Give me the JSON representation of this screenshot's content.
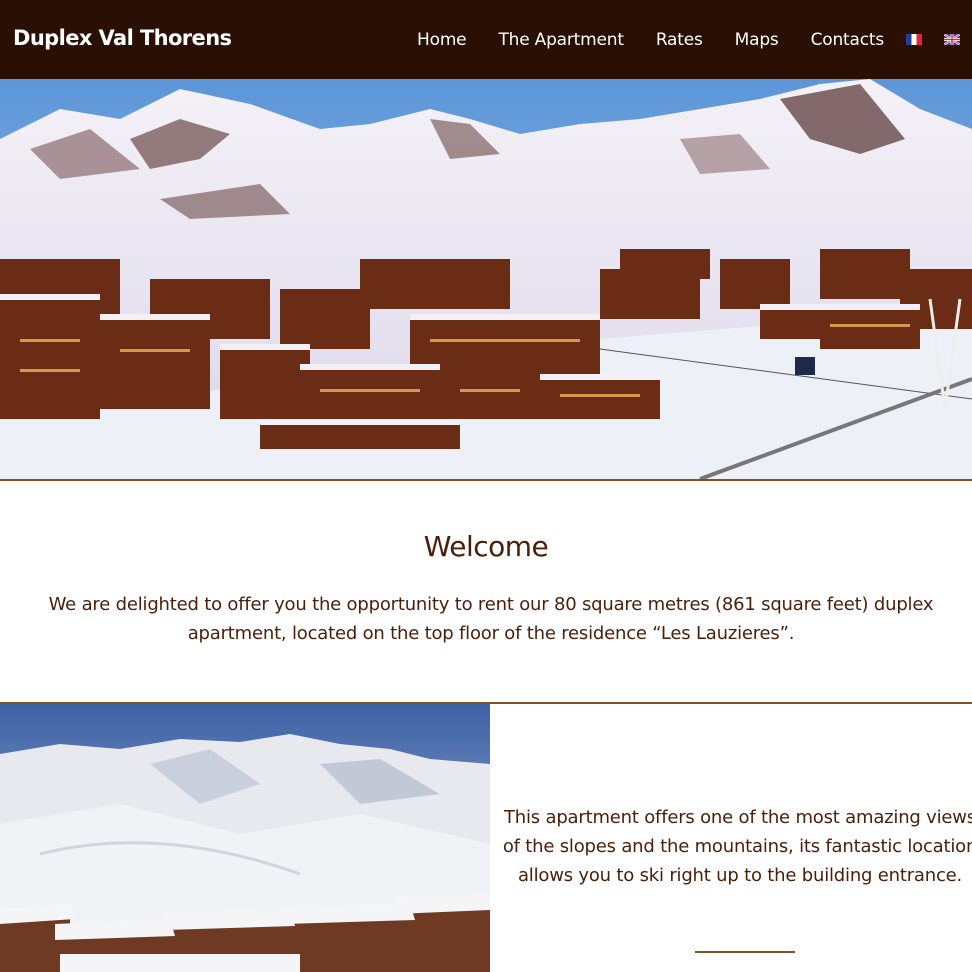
{
  "header": {
    "site_title": "Duplex Val Thorens",
    "nav": [
      {
        "label": "Home"
      },
      {
        "label": "The Apartment"
      },
      {
        "label": "Rates"
      },
      {
        "label": "Maps"
      },
      {
        "label": "Contacts"
      }
    ],
    "languages": [
      "fr-flag-icon",
      "uk-flag-icon"
    ]
  },
  "colors": {
    "header_bg": "#2a0f04",
    "accent": "#8a4f1c",
    "text": "#4a1e08"
  },
  "welcome": {
    "title": "Welcome",
    "text": "We are delighted to offer you the opportunity to rent our 80 square metres (861 square feet) duplex apartment, located on the top floor of the residence “Les Lauzieres”."
  },
  "feature": {
    "text": "This apartment offers one of the most amazing views of the slopes and the mountains, its fantastic location allows you to ski right up to the building entrance."
  }
}
